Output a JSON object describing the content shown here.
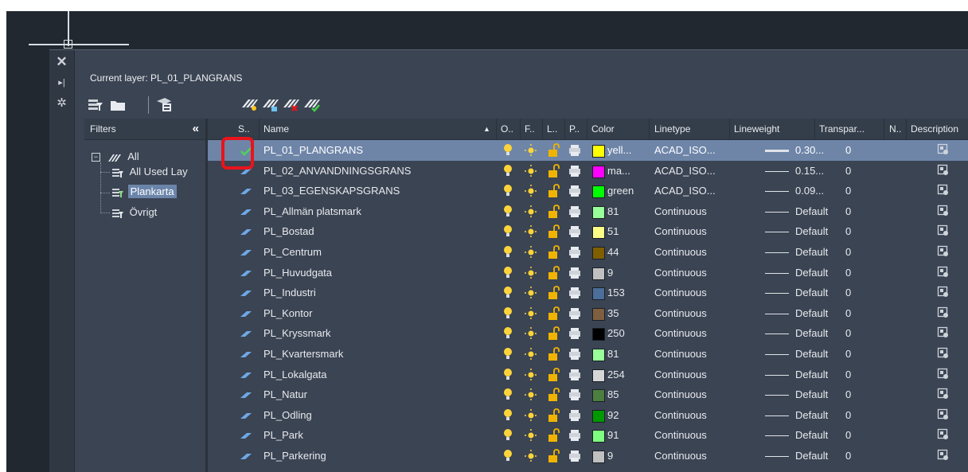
{
  "current_layer": {
    "label": "Current layer: PL_01_PLANGRANS"
  },
  "strip_icons": [
    "close-icon",
    "pin-icon",
    "settings-icon"
  ],
  "toolbar": {
    "left_icons": [
      "new-property-filter-icon",
      "new-group-filter-icon",
      "layer-states-manager-icon"
    ],
    "layer_icons": [
      "new-layer-icon",
      "new-layer-vp-frozen-icon",
      "delete-layer-icon",
      "set-current-icon"
    ]
  },
  "filters": {
    "header": "Filters",
    "collapse_glyph": "«",
    "tree": {
      "root": "All",
      "children": [
        "All Used Lay",
        "Plankarta",
        "Övrigt"
      ],
      "selected": "Plankarta"
    }
  },
  "grid": {
    "columns": [
      "S..",
      "Name",
      "O..",
      "F..",
      "L..",
      "P..",
      "Color",
      "Linetype",
      "Lineweight",
      "Transpar...",
      "N..",
      "Description"
    ],
    "sort_glyph": "▲",
    "current_row": 0,
    "rows": [
      {
        "name": "PL_01_PLANGRANS",
        "status": "current",
        "color_hex": "#ffff00",
        "color": "yell...",
        "linetype": "ACAD_ISO...",
        "lineweight": "0.30...",
        "lw_thick": true,
        "transparency": "0"
      },
      {
        "name": "PL_02_ANVANDNINGSGRANS",
        "status": "layer",
        "color_hex": "#ff00ff",
        "color": "ma...",
        "linetype": "ACAD_ISO...",
        "lineweight": "0.15...",
        "lw_thick": false,
        "transparency": "0"
      },
      {
        "name": "PL_03_EGENSKAPSGRANS",
        "status": "layer",
        "color_hex": "#00ff00",
        "color": "green",
        "linetype": "ACAD_ISO...",
        "lineweight": "0.09...",
        "lw_thick": false,
        "transparency": "0"
      },
      {
        "name": "PL_Allmän platsmark",
        "status": "layer",
        "color_hex": "#99ff99",
        "color": "81",
        "linetype": "Continuous",
        "lineweight": "Default",
        "lw_thick": false,
        "transparency": "0"
      },
      {
        "name": "PL_Bostad",
        "status": "layer",
        "color_hex": "#ffff88",
        "color": "51",
        "linetype": "Continuous",
        "lineweight": "Default",
        "lw_thick": false,
        "transparency": "0"
      },
      {
        "name": "PL_Centrum",
        "status": "layer",
        "color_hex": "#7f5f00",
        "color": "44",
        "linetype": "Continuous",
        "lineweight": "Default",
        "lw_thick": false,
        "transparency": "0"
      },
      {
        "name": "PL_Huvudgata",
        "status": "layer",
        "color_hex": "#c0c0c0",
        "color": "9",
        "linetype": "Continuous",
        "lineweight": "Default",
        "lw_thick": false,
        "transparency": "0"
      },
      {
        "name": "PL_Industri",
        "status": "layer",
        "color_hex": "#4c6e9a",
        "color": "153",
        "linetype": "Continuous",
        "lineweight": "Default",
        "lw_thick": false,
        "transparency": "0"
      },
      {
        "name": "PL_Kontor",
        "status": "layer",
        "color_hex": "#7f5f3f",
        "color": "35",
        "linetype": "Continuous",
        "lineweight": "Default",
        "lw_thick": false,
        "transparency": "0"
      },
      {
        "name": "PL_Kryssmark",
        "status": "layer",
        "color_hex": "#000000",
        "color": "250",
        "linetype": "Continuous",
        "lineweight": "Default",
        "lw_thick": false,
        "transparency": "0"
      },
      {
        "name": "PL_Kvartersmark",
        "status": "layer",
        "color_hex": "#99ff99",
        "color": "81",
        "linetype": "Continuous",
        "lineweight": "Default",
        "lw_thick": false,
        "transparency": "0"
      },
      {
        "name": "PL_Lokalgata",
        "status": "layer",
        "color_hex": "#d6d6d6",
        "color": "254",
        "linetype": "Continuous",
        "lineweight": "Default",
        "lw_thick": false,
        "transparency": "0"
      },
      {
        "name": "PL_Natur",
        "status": "layer",
        "color_hex": "#4c7f3f",
        "color": "85",
        "linetype": "Continuous",
        "lineweight": "Default",
        "lw_thick": false,
        "transparency": "0"
      },
      {
        "name": "PL_Odling",
        "status": "layer",
        "color_hex": "#009900",
        "color": "92",
        "linetype": "Continuous",
        "lineweight": "Default",
        "lw_thick": false,
        "transparency": "0"
      },
      {
        "name": "PL_Park",
        "status": "layer",
        "color_hex": "#7fff7f",
        "color": "91",
        "linetype": "Continuous",
        "lineweight": "Default",
        "lw_thick": false,
        "transparency": "0"
      },
      {
        "name": "PL_Parkering",
        "status": "layer",
        "color_hex": "#c0c0c0",
        "color": "9",
        "linetype": "Continuous",
        "lineweight": "Default",
        "lw_thick": false,
        "transparency": "0"
      }
    ]
  },
  "colors": {
    "accent_highlight": "#e8141b",
    "selected_row": "#6e85a8",
    "bulb_on": "#ffd43b",
    "sun": "#ffd43b",
    "lock_open": "#f0b400"
  }
}
